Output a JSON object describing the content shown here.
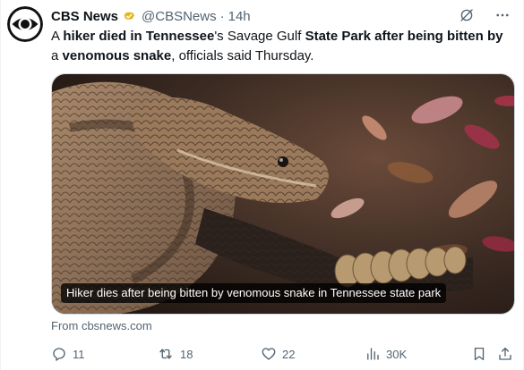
{
  "account": {
    "display_name": "CBS News",
    "handle": "@CBSNews",
    "separator": "·",
    "timestamp": "14h"
  },
  "tweet": {
    "segments": [
      {
        "text": "A ",
        "bold": false
      },
      {
        "text": "hiker died in Tennessee",
        "bold": true
      },
      {
        "text": "'s Savage Gulf ",
        "bold": false
      },
      {
        "text": "State Park after being bitten by",
        "bold": true
      },
      {
        "text": " a ",
        "bold": false
      },
      {
        "text": "venomous snake",
        "bold": true
      },
      {
        "text": ", officials said Thursday.",
        "bold": false
      }
    ]
  },
  "media": {
    "caption": "Hiker dies after being bitten by venomous snake in Tennessee state park"
  },
  "link_source": "From cbsnews.com",
  "engagement": {
    "replies": "11",
    "reposts": "18",
    "likes": "22",
    "views": "30K"
  },
  "icons": {
    "avatar": "cbs-eye-logo",
    "verified": "verified-badge-gold",
    "grok": "grok-icon",
    "more": "more-icon",
    "reply": "reply-icon",
    "repost": "repost-icon",
    "like": "heart-icon",
    "views": "views-icon",
    "bookmark": "bookmark-icon",
    "share": "share-icon"
  },
  "colors": {
    "text_primary": "#0f1419",
    "text_secondary": "#536471",
    "verified_gold": "#e2b719",
    "border": "#cfd9de"
  }
}
